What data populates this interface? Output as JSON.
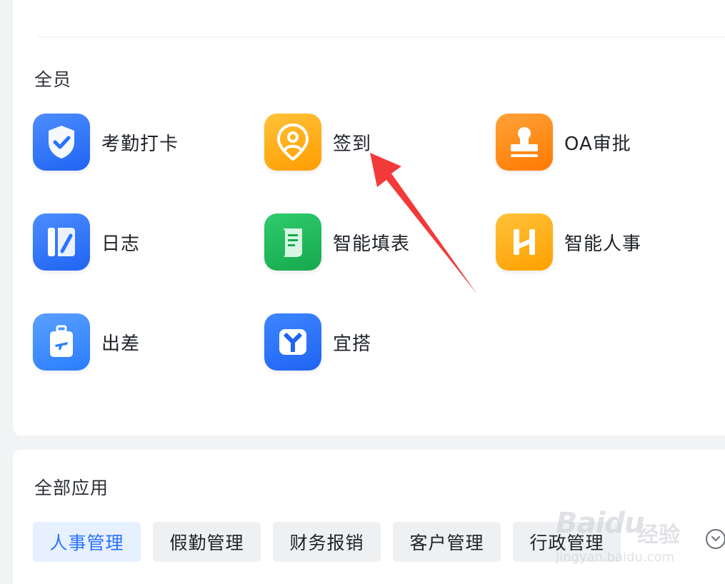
{
  "section_all_staff": {
    "title": "全员"
  },
  "apps": {
    "attendance": {
      "label": "考勤打卡",
      "icon": "shield-check-icon",
      "color": "#2a72ff"
    },
    "checkin": {
      "label": "签到",
      "icon": "location-pin-icon",
      "color": "#ffa800"
    },
    "oa_approval": {
      "label": "OA审批",
      "icon": "stamp-icon",
      "color": "#ff8a00"
    },
    "diary": {
      "label": "日志",
      "icon": "notebook-icon",
      "color": "#2a72ff"
    },
    "smart_form": {
      "label": "智能填表",
      "icon": "scroll-form-icon",
      "color": "#1fb85a"
    },
    "smart_hr": {
      "label": "智能人事",
      "icon": "h-logo-icon",
      "color": "#ffaa00"
    },
    "business_trip": {
      "label": "出差",
      "icon": "suitcase-plane-icon",
      "color": "#3b8cff"
    },
    "yida": {
      "label": "宜搭",
      "icon": "y-logo-icon",
      "color": "#2a72ff"
    }
  },
  "section_all_apps": {
    "title": "全部应用"
  },
  "category_tags": [
    {
      "label": "人事管理",
      "active": true
    },
    {
      "label": "假勤管理",
      "active": false
    },
    {
      "label": "财务报销",
      "active": false
    },
    {
      "label": "客户管理",
      "active": false
    },
    {
      "label": "行政管理",
      "active": false
    }
  ],
  "more_icon": "chevron-down-circle-icon",
  "annotation": {
    "arrow_color": "#f23a3a"
  },
  "watermark": {
    "logo": "Baidu",
    "cn": "经验",
    "url": "jingyan.baidu.com"
  }
}
